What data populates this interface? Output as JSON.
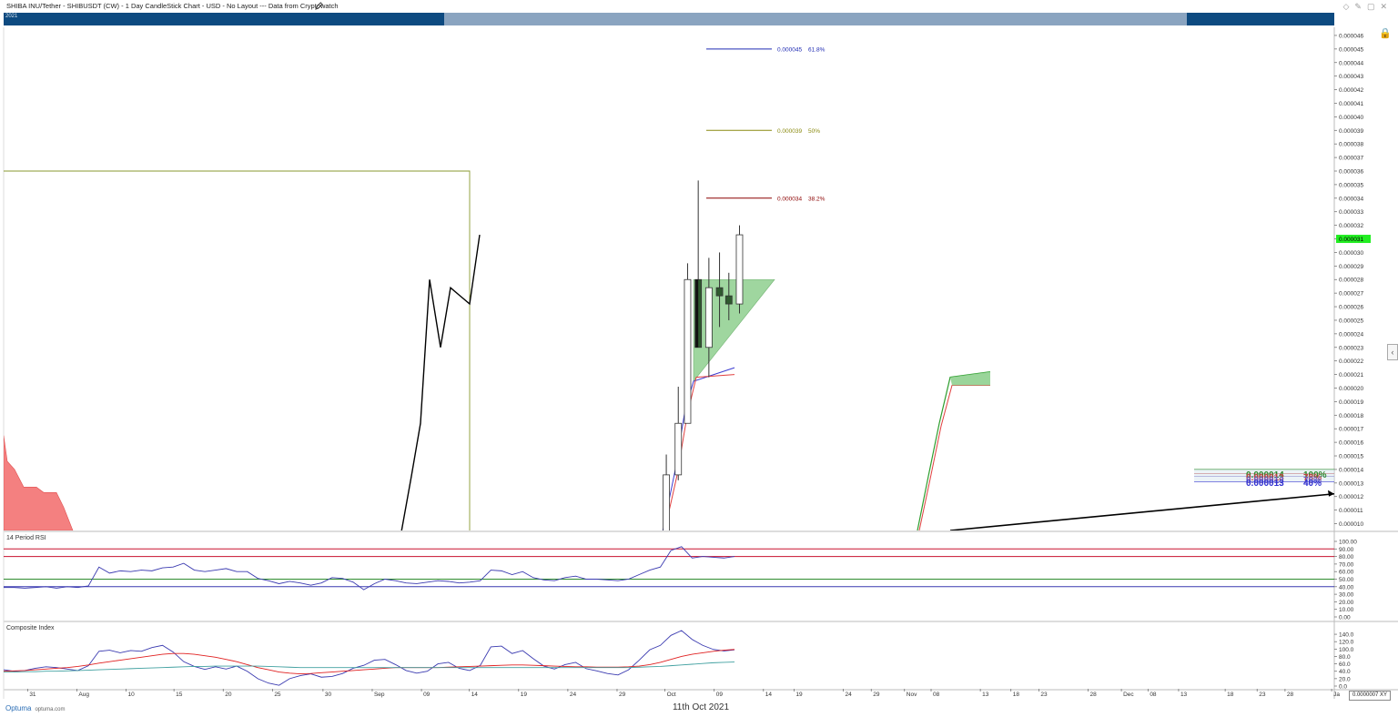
{
  "header": {
    "title": "SHIBA INU/Tether - SHIBUSDT (CW) - 1 Day CandleStick Chart - USD - No Layout --- Data from Cryptowatch",
    "nav_year": "2021"
  },
  "footer": {
    "date": "11th Oct 2021",
    "brand": "Optuma",
    "brand_url": "optuma.com",
    "xy_value": "0.0000007",
    "xy_label": "XY"
  },
  "colors": {
    "fib_618": "#1f2bb3",
    "fib_50": "#8a8a10",
    "fib_382": "#8b0000",
    "last_price_bg": "#22ee22",
    "triangle_fill": "#8fd08f",
    "cloud_red": "#f48080",
    "rsi_line": "#3a3ab0",
    "rsi_upper": "#c8102e",
    "rsi_mid": "#2e8b2e",
    "ci_line": "#3a3ab0",
    "ci_ma_red": "#e02020",
    "ci_ma_teal": "#40a0a0",
    "nav_dark": "#0d4a80"
  },
  "chart_data": [
    {
      "type": "candlestick",
      "title": "SHIBA INU/Tether - SHIBUSDT (CW) - 1 Day CandleStick Chart - USD",
      "ylim": [
        9.5e-06,
        4.66e-05
      ],
      "y_ticks": [
        "0.000010",
        "0.000011",
        "0.000012",
        "0.000013",
        "0.000014",
        "0.000015",
        "0.000016",
        "0.000017",
        "0.000018",
        "0.000019",
        "0.000020",
        "0.000021",
        "0.000022",
        "0.000023",
        "0.000024",
        "0.000025",
        "0.000026",
        "0.000027",
        "0.000028",
        "0.000029",
        "0.000030",
        "0.000031",
        "0.000032",
        "0.000033",
        "0.000034",
        "0.000035",
        "0.000036",
        "0.000037",
        "0.000038",
        "0.000039",
        "0.000040",
        "0.000041",
        "0.000042",
        "0.000043",
        "0.000044",
        "0.000045",
        "0.000046"
      ],
      "x_ticks": [
        {
          "label": "31",
          "pos": 0.018
        },
        {
          "label": "Aug",
          "pos": 0.055
        },
        {
          "label": "10",
          "pos": 0.092
        },
        {
          "label": "15",
          "pos": 0.128
        },
        {
          "label": "20",
          "pos": 0.165
        },
        {
          "label": "25",
          "pos": 0.202
        },
        {
          "label": "30",
          "pos": 0.24
        },
        {
          "label": "Sep",
          "pos": 0.277
        },
        {
          "label": "09",
          "pos": 0.314
        },
        {
          "label": "14",
          "pos": 0.35
        },
        {
          "label": "19",
          "pos": 0.387
        },
        {
          "label": "24",
          "pos": 0.424
        },
        {
          "label": "29",
          "pos": 0.461
        },
        {
          "label": "Oct",
          "pos": 0.497
        },
        {
          "label": "09",
          "pos": 0.534
        },
        {
          "label": "14",
          "pos": 0.571
        },
        {
          "label": "19",
          "pos": 0.594
        },
        {
          "label": "24",
          "pos": 0.631
        },
        {
          "label": "29",
          "pos": 0.652
        },
        {
          "label": "Nov",
          "pos": 0.677
        },
        {
          "label": "08",
          "pos": 0.697
        },
        {
          "label": "13",
          "pos": 0.734
        },
        {
          "label": "18",
          "pos": 0.757
        },
        {
          "label": "23",
          "pos": 0.778
        },
        {
          "label": "28",
          "pos": 0.815
        },
        {
          "label": "Dec",
          "pos": 0.84
        },
        {
          "label": "08",
          "pos": 0.86
        },
        {
          "label": "13",
          "pos": 0.883
        },
        {
          "label": "18",
          "pos": 0.918
        },
        {
          "label": "23",
          "pos": 0.942
        },
        {
          "label": "28",
          "pos": 0.963
        },
        {
          "label": "Ja",
          "pos": 0.998
        }
      ],
      "last_price": "0.000031",
      "candles": [
        {
          "pos": 0.498,
          "o": 9.4e-06,
          "h": 1.51e-05,
          "l": 9.4e-06,
          "c": 1.36e-05
        },
        {
          "pos": 0.507,
          "o": 1.36e-05,
          "h": 2.01e-05,
          "l": 1.32e-05,
          "c": 1.74e-05
        },
        {
          "pos": 0.514,
          "o": 1.74e-05,
          "h": 2.92e-05,
          "l": 1.74e-05,
          "c": 2.8e-05
        },
        {
          "pos": 0.522,
          "o": 2.8e-05,
          "h": 3.53e-05,
          "l": 2.3e-05,
          "c": 2.3e-05
        },
        {
          "pos": 0.53,
          "o": 2.3e-05,
          "h": 2.96e-05,
          "l": 2.08e-05,
          "c": 2.74e-05
        },
        {
          "pos": 0.538,
          "o": 2.74e-05,
          "h": 3e-05,
          "l": 2.45e-05,
          "c": 2.68e-05
        },
        {
          "pos": 0.545,
          "o": 2.68e-05,
          "h": 2.85e-05,
          "l": 2.5e-05,
          "c": 2.62e-05
        },
        {
          "pos": 0.553,
          "o": 2.62e-05,
          "h": 3.2e-05,
          "l": 2.55e-05,
          "c": 3.13e-05
        }
      ],
      "fib_levels": [
        {
          "price": 4.5e-05,
          "label": "0.000045",
          "pct": "61.8%"
        },
        {
          "price": 3.9e-05,
          "label": "0.000039",
          "pct": "50%"
        },
        {
          "price": 3.4e-05,
          "label": "0.000034",
          "pct": "38.2%"
        }
      ],
      "bottom_right_labels": [
        {
          "price": "0.000014",
          "pct": "100%"
        },
        {
          "price": "0.000013",
          "pct": "78%"
        },
        {
          "price": "0.000013",
          "pct": "76%"
        },
        {
          "price": "0.000013",
          "pct": "40%"
        }
      ]
    },
    {
      "type": "line",
      "title": "14 Period RSI",
      "ylim": [
        0,
        100
      ],
      "y_ticks": [
        "100.00",
        "90.00",
        "80.00",
        "70.00",
        "60.00",
        "50.00",
        "40.00",
        "30.00",
        "20.00",
        "10.00",
        "0.00"
      ],
      "ref_lines": [
        90,
        80,
        50,
        40
      ],
      "values": [
        39,
        39,
        38,
        39,
        40,
        38,
        40,
        39,
        41,
        66,
        58,
        61,
        60,
        62,
        61,
        65,
        66,
        71,
        62,
        60,
        62,
        64,
        60,
        60,
        51,
        48,
        44,
        47,
        45,
        42,
        45,
        52,
        51,
        46,
        36,
        44,
        50,
        48,
        45,
        44,
        46,
        48,
        47,
        45,
        46,
        48,
        62,
        61,
        56,
        60,
        52,
        49,
        48,
        52,
        54,
        50,
        50,
        49,
        48,
        50,
        56,
        62,
        66,
        88,
        93,
        78,
        80,
        79,
        78,
        80
      ]
    },
    {
      "type": "line",
      "title": "Composite Index",
      "ylim": [
        0,
        150
      ],
      "y_ticks": [
        "140.0",
        "120.0",
        "100.0",
        "80.0",
        "60.0",
        "40.0",
        "20.0",
        "0.0"
      ],
      "series": [
        {
          "values": [
            44,
            40,
            42,
            48,
            52,
            50,
            46,
            42,
            55,
            94,
            97,
            90,
            96,
            94,
            104,
            110,
            92,
            66,
            53,
            45,
            52,
            46,
            54,
            40,
            20,
            8,
            2,
            20,
            28,
            33,
            24,
            26,
            34,
            48,
            56,
            70,
            72,
            58,
            42,
            35,
            40,
            60,
            64,
            48,
            42,
            56,
            106,
            108,
            88,
            96,
            74,
            54,
            46,
            58,
            64,
            47,
            41,
            34,
            30,
            44,
            70,
            98,
            110,
            137,
            150,
            126,
            110,
            99,
            95,
            98
          ]
        },
        {
          "values": [
            40,
            41,
            42,
            44,
            46,
            48,
            50,
            53,
            57,
            62,
            66,
            70,
            74,
            78,
            82,
            86,
            88,
            88,
            86,
            82,
            78,
            72,
            66,
            58,
            50,
            44,
            38,
            35,
            33,
            34,
            36,
            38,
            40,
            42,
            44,
            46,
            48,
            50,
            50,
            50,
            50,
            50,
            51,
            52,
            53,
            54,
            55,
            56,
            57,
            57,
            56,
            55,
            54,
            53,
            52,
            52,
            51,
            51,
            51,
            52,
            54,
            58,
            64,
            72,
            80,
            86,
            90,
            94,
            97,
            99
          ]
        },
        {
          "values": [
            38,
            38,
            39,
            39,
            40,
            40,
            41,
            42,
            43,
            44,
            45,
            46,
            47,
            48,
            49,
            50,
            51,
            52,
            53,
            53,
            54,
            54,
            54,
            54,
            54,
            53,
            52,
            51,
            50,
            50,
            50,
            50,
            50,
            50,
            50,
            50,
            50,
            50,
            50,
            50,
            50,
            50,
            50,
            50,
            50,
            50,
            50,
            50,
            50,
            50,
            50,
            50,
            50,
            50,
            50,
            50,
            50,
            50,
            50,
            50,
            51,
            52,
            53,
            55,
            57,
            59,
            61,
            63,
            64,
            65
          ]
        }
      ]
    }
  ]
}
